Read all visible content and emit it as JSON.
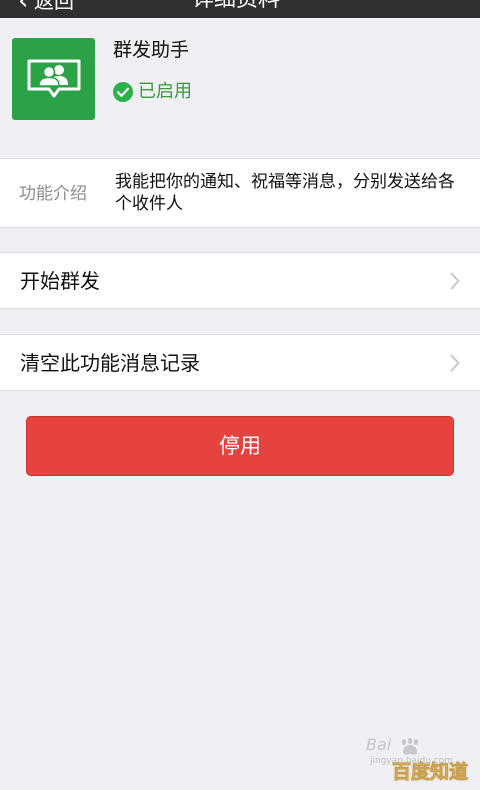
{
  "nav": {
    "back_glyph": "‹",
    "back_label": "返回",
    "title": "详细资料"
  },
  "profile": {
    "name": "群发助手",
    "status": "已启用",
    "status_color": "#3a9a3c",
    "icon": "group-chat-icon",
    "icon_bg": "#2ba245"
  },
  "intro": {
    "label": "功能介绍",
    "text": "我能把你的通知、祝福等消息，分别发送给各个收件人"
  },
  "rows": [
    {
      "label": "开始群发",
      "icon": "chevron-right-icon"
    },
    {
      "label": "清空此功能消息记录",
      "icon": "chevron-right-icon"
    }
  ],
  "disable_button": {
    "label": "停用",
    "color": "#e64340"
  },
  "watermark": {
    "brand": "Bai",
    "sub": "jingyan.baidu.com",
    "logo": "百度知道"
  }
}
